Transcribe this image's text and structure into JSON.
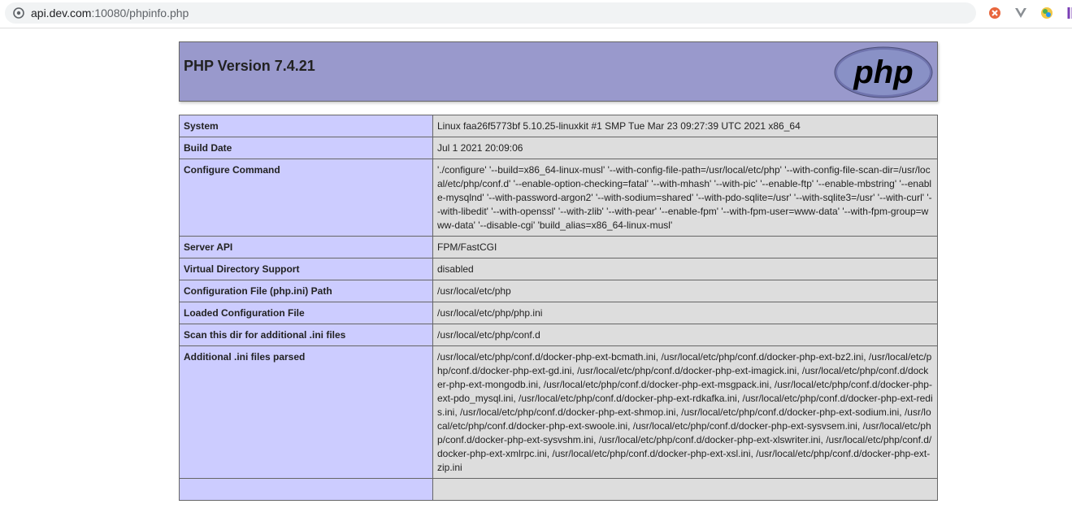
{
  "browser": {
    "url_host": "api.dev.com",
    "url_rest": ":10080/phpinfo.php",
    "site_icon": "site-info-icon",
    "extensions": [
      "extension-orange-icon",
      "extension-vue-icon",
      "extension-color-icon",
      "extension-purple-icon"
    ]
  },
  "header": {
    "title": "PHP Version 7.4.21",
    "logo_text": "php"
  },
  "rows": [
    {
      "label": "System",
      "value": "Linux faa26f5773bf 5.10.25-linuxkit #1 SMP Tue Mar 23 09:27:39 UTC 2021 x86_64"
    },
    {
      "label": "Build Date",
      "value": "Jul 1 2021 20:09:06"
    },
    {
      "label": "Configure Command",
      "value": "'./configure' '--build=x86_64-linux-musl' '--with-config-file-path=/usr/local/etc/php' '--with-config-file-scan-dir=/usr/local/etc/php/conf.d' '--enable-option-checking=fatal' '--with-mhash' '--with-pic' '--enable-ftp' '--enable-mbstring' '--enable-mysqlnd' '--with-password-argon2' '--with-sodium=shared' '--with-pdo-sqlite=/usr' '--with-sqlite3=/usr' '--with-curl' '--with-libedit' '--with-openssl' '--with-zlib' '--with-pear' '--enable-fpm' '--with-fpm-user=www-data' '--with-fpm-group=www-data' '--disable-cgi' 'build_alias=x86_64-linux-musl'"
    },
    {
      "label": "Server API",
      "value": "FPM/FastCGI"
    },
    {
      "label": "Virtual Directory Support",
      "value": "disabled"
    },
    {
      "label": "Configuration File (php.ini) Path",
      "value": "/usr/local/etc/php"
    },
    {
      "label": "Loaded Configuration File",
      "value": "/usr/local/etc/php/php.ini"
    },
    {
      "label": "Scan this dir for additional .ini files",
      "value": "/usr/local/etc/php/conf.d"
    },
    {
      "label": "Additional .ini files parsed",
      "value": "/usr/local/etc/php/conf.d/docker-php-ext-bcmath.ini, /usr/local/etc/php/conf.d/docker-php-ext-bz2.ini, /usr/local/etc/php/conf.d/docker-php-ext-gd.ini, /usr/local/etc/php/conf.d/docker-php-ext-imagick.ini, /usr/local/etc/php/conf.d/docker-php-ext-mongodb.ini, /usr/local/etc/php/conf.d/docker-php-ext-msgpack.ini, /usr/local/etc/php/conf.d/docker-php-ext-pdo_mysql.ini, /usr/local/etc/php/conf.d/docker-php-ext-rdkafka.ini, /usr/local/etc/php/conf.d/docker-php-ext-redis.ini, /usr/local/etc/php/conf.d/docker-php-ext-shmop.ini, /usr/local/etc/php/conf.d/docker-php-ext-sodium.ini, /usr/local/etc/php/conf.d/docker-php-ext-swoole.ini, /usr/local/etc/php/conf.d/docker-php-ext-sysvsem.ini, /usr/local/etc/php/conf.d/docker-php-ext-sysvshm.ini, /usr/local/etc/php/conf.d/docker-php-ext-xlswriter.ini, /usr/local/etc/php/conf.d/docker-php-ext-xmlrpc.ini, /usr/local/etc/php/conf.d/docker-php-ext-xsl.ini, /usr/local/etc/php/conf.d/docker-php-ext-zip.ini"
    },
    {
      "label": "",
      "value": ""
    }
  ],
  "colors": {
    "header_bg": "#9999cc",
    "label_bg": "#ccccff",
    "value_bg": "#dddddd"
  }
}
